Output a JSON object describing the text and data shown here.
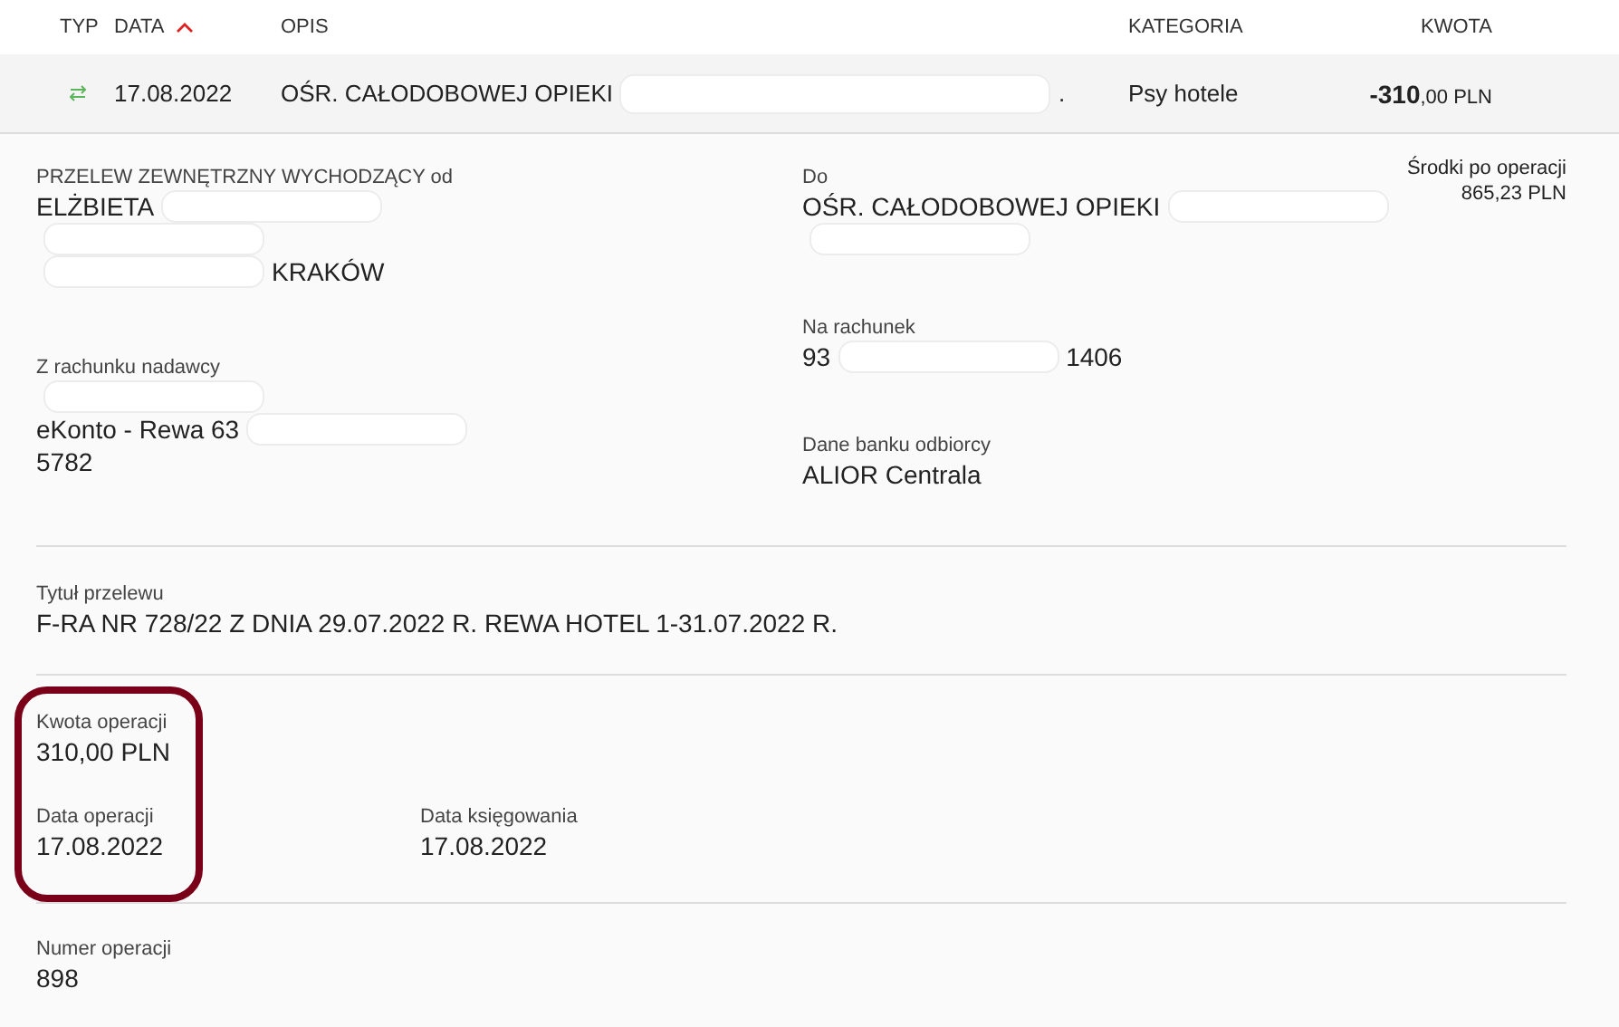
{
  "table": {
    "columns": [
      {
        "label": "TYP",
        "sorted": false
      },
      {
        "label": "DATA",
        "sorted": true
      },
      {
        "label": "OPIS",
        "sorted": false
      },
      {
        "label": "KATEGORIA",
        "sorted": false
      },
      {
        "label": "KWOTA",
        "sorted": false
      }
    ],
    "row": {
      "date": "17.08.2022",
      "description": {
        "before": "OŚR. CAŁODOBOWEJ OPIEKI",
        "redacted": true,
        "after": "."
      },
      "category": "Psy hotele",
      "amount": "**-310**,00 PLN"
    }
  },
  "details": {
    "left": [
      {
        "label": "PRZELEW ZEWNĘTRZNY WYCHODZĄCY od",
        "lines": [
          {
            "before": "ELŻBIETA",
            "redacted": true
          },
          {
            "redacted": true
          },
          {
            "redacted": true,
            "after": "KRAKÓW"
          }
        ]
      },
      {
        "label": "Z rachunku nadawcy",
        "lines": [
          {
            "redacted": true
          },
          {
            "before": "eKonto - Rewa 63",
            "redacted": true
          },
          {
            "before": "5782"
          }
        ]
      }
    ],
    "right": [
      {
        "label": "Do",
        "lines": [
          {
            "before": "OŚR. CAŁODOBOWEJ OPIEKI",
            "redacted": true
          },
          {
            "redacted": true
          }
        ]
      },
      {
        "label": "Na rachunek",
        "lines": [
          {
            "before": "93",
            "redacted": true,
            "after": "1406"
          }
        ]
      },
      {
        "label": "Dane banku odbiorcy",
        "lines": [
          {
            "before": "ALIOR Centrala"
          }
        ]
      }
    ],
    "balance": {
      "label": "Środki po operacji",
      "value": "865,23 PLN"
    },
    "title": {
      "label": "Tytuł przelewu",
      "value": "F-RA NR 728/22 Z DNIA 29.07.2022 R. REWA HOTEL 1-31.07.2022 R."
    },
    "amount": {
      "label": "Kwota operacji",
      "value": "310,00 PLN"
    },
    "operation_date": {
      "label": "Data operacji",
      "value": "17.08.2022"
    },
    "booking_date": {
      "label": "Data księgowania",
      "value": "17.08.2022"
    },
    "highlighted": true,
    "number": {
      "label": "Numer operacji",
      "value": "898"
    }
  }
}
